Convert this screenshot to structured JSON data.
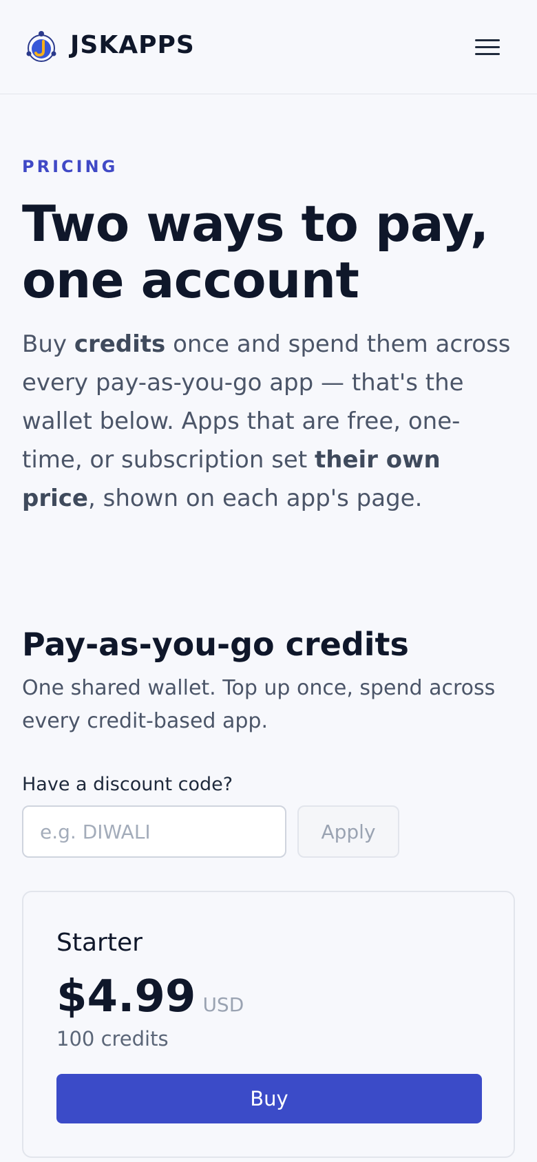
{
  "header": {
    "brand": "JSKAPPS",
    "logo_icon": "jskapps-logo-icon",
    "menu_icon": "hamburger-menu-icon"
  },
  "hero": {
    "eyebrow": "PRICING",
    "title": "Two ways to pay, one account",
    "desc_part1": "Buy ",
    "desc_bold1": "credits",
    "desc_part2": " once and spend them across every pay-as-you-go app — that's the wallet below. Apps that are free, one-time, or subscription set ",
    "desc_bold2": "their own price",
    "desc_part3": ", shown on each app's page."
  },
  "credits_section": {
    "title": "Pay-as-you-go credits",
    "desc": "One shared wallet. Top up once, spend across every credit-based app.",
    "discount_label": "Have a discount code?",
    "discount_placeholder": "e.g. DIWALI",
    "discount_value": "",
    "apply_label": "Apply"
  },
  "plans": [
    {
      "name": "Starter",
      "price": "$4.99",
      "currency": "USD",
      "credits": "100 credits",
      "buy_label": "Buy"
    }
  ],
  "colors": {
    "accent": "#3b4bc8",
    "eyebrow": "#4049c6",
    "background": "#f7f8fc",
    "text": "#0f172a",
    "muted": "#4b5568"
  }
}
